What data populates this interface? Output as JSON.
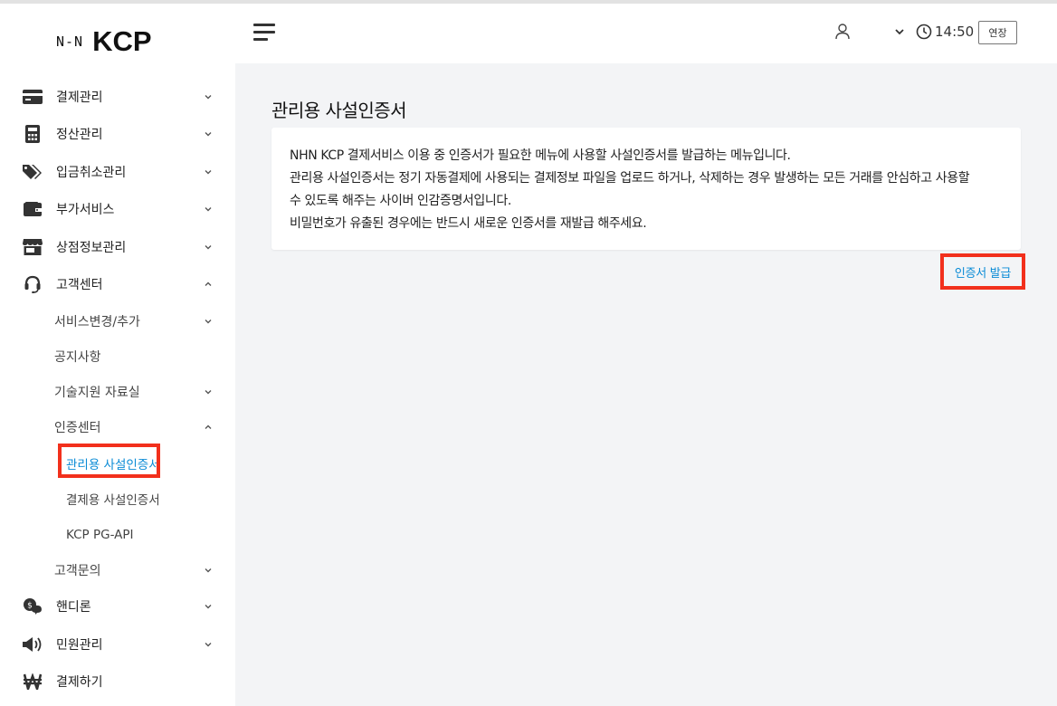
{
  "logo": {
    "nhn": "N‑N",
    "kcp": "KCP"
  },
  "sidebar": {
    "items": [
      {
        "name": "payment",
        "icon": "credit-card-icon",
        "label": "결제관리",
        "expanded": false
      },
      {
        "name": "settlement",
        "icon": "calculator-icon",
        "label": "정산관리",
        "expanded": false
      },
      {
        "name": "deposit-cancel",
        "icon": "tags-icon",
        "label": "입금취소관리",
        "expanded": false
      },
      {
        "name": "extra-services",
        "icon": "wallet-icon",
        "label": "부가서비스",
        "expanded": false
      },
      {
        "name": "store-info",
        "icon": "store-icon",
        "label": "상점정보관리",
        "expanded": false
      },
      {
        "name": "customer-center",
        "icon": "headset-icon",
        "label": "고객센터",
        "expanded": true
      }
    ],
    "customer_center_sub": [
      {
        "label": "서비스변경/추가",
        "chevron": "down"
      },
      {
        "label": "공지사항",
        "chevron": ""
      },
      {
        "label": "기술지원 자료실",
        "chevron": "down"
      },
      {
        "label": "인증센터",
        "chevron": "up"
      }
    ],
    "cert_center_sub": [
      {
        "label": "관리용 사설인증서",
        "active": true
      },
      {
        "label": "결제용 사설인증서",
        "active": false
      },
      {
        "label": "KCP PG-API",
        "active": false
      }
    ],
    "customer_inquiry": "고객문의",
    "bottom_items": [
      {
        "name": "handy-loan",
        "icon": "coin-chat-icon",
        "label": "핸디론",
        "expanded": false
      },
      {
        "name": "complaints",
        "icon": "megaphone-icon",
        "label": "민원관리",
        "expanded": false
      },
      {
        "name": "pay",
        "icon": "won-icon",
        "label": "결제하기"
      }
    ]
  },
  "header": {
    "time": "14:50",
    "extend_label": "연장"
  },
  "main": {
    "title": "관리용 사설인증서",
    "description": [
      "NHN KCP 결제서비스 이용 중 인증서가 필요한 메뉴에 사용할 사설인증서를 발급하는 메뉴입니다.",
      "관리용 사설인증서는 정기 자동결제에 사용되는 결제정보 파일을 업로드 하거나, 삭제하는 경우 발생하는 모든 거래를 안심하고 사용할",
      "수 있도록 해주는 사이버 인감증명서입니다.",
      "비밀번호가 유출된 경우에는 반드시 새로운 인증서를 재발급 해주세요."
    ],
    "issue_button": "인증서 발급"
  },
  "colors": {
    "accent": "#0a8bd6",
    "highlight": "#f2301c",
    "background": "#f3f4f6"
  }
}
